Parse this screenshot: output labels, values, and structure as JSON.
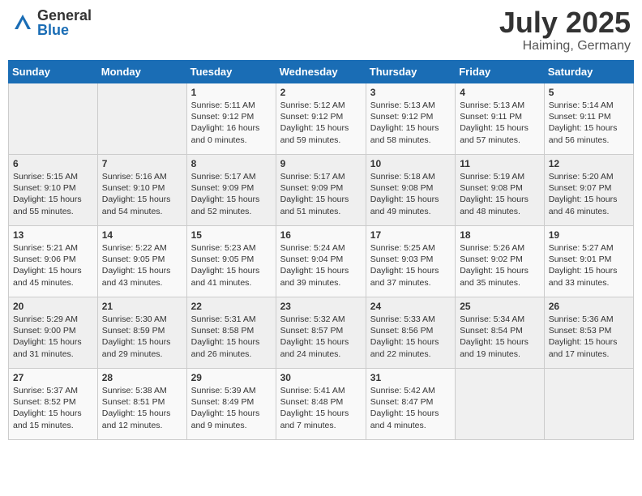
{
  "header": {
    "logo": {
      "general": "General",
      "blue": "Blue"
    },
    "title": "July 2025",
    "location": "Haiming, Germany"
  },
  "days_of_week": [
    "Sunday",
    "Monday",
    "Tuesday",
    "Wednesday",
    "Thursday",
    "Friday",
    "Saturday"
  ],
  "weeks": [
    [
      {
        "day": "",
        "info": ""
      },
      {
        "day": "",
        "info": ""
      },
      {
        "day": "1",
        "info": "Sunrise: 5:11 AM\nSunset: 9:12 PM\nDaylight: 16 hours\nand 0 minutes."
      },
      {
        "day": "2",
        "info": "Sunrise: 5:12 AM\nSunset: 9:12 PM\nDaylight: 15 hours\nand 59 minutes."
      },
      {
        "day": "3",
        "info": "Sunrise: 5:13 AM\nSunset: 9:12 PM\nDaylight: 15 hours\nand 58 minutes."
      },
      {
        "day": "4",
        "info": "Sunrise: 5:13 AM\nSunset: 9:11 PM\nDaylight: 15 hours\nand 57 minutes."
      },
      {
        "day": "5",
        "info": "Sunrise: 5:14 AM\nSunset: 9:11 PM\nDaylight: 15 hours\nand 56 minutes."
      }
    ],
    [
      {
        "day": "6",
        "info": "Sunrise: 5:15 AM\nSunset: 9:10 PM\nDaylight: 15 hours\nand 55 minutes."
      },
      {
        "day": "7",
        "info": "Sunrise: 5:16 AM\nSunset: 9:10 PM\nDaylight: 15 hours\nand 54 minutes."
      },
      {
        "day": "8",
        "info": "Sunrise: 5:17 AM\nSunset: 9:09 PM\nDaylight: 15 hours\nand 52 minutes."
      },
      {
        "day": "9",
        "info": "Sunrise: 5:17 AM\nSunset: 9:09 PM\nDaylight: 15 hours\nand 51 minutes."
      },
      {
        "day": "10",
        "info": "Sunrise: 5:18 AM\nSunset: 9:08 PM\nDaylight: 15 hours\nand 49 minutes."
      },
      {
        "day": "11",
        "info": "Sunrise: 5:19 AM\nSunset: 9:08 PM\nDaylight: 15 hours\nand 48 minutes."
      },
      {
        "day": "12",
        "info": "Sunrise: 5:20 AM\nSunset: 9:07 PM\nDaylight: 15 hours\nand 46 minutes."
      }
    ],
    [
      {
        "day": "13",
        "info": "Sunrise: 5:21 AM\nSunset: 9:06 PM\nDaylight: 15 hours\nand 45 minutes."
      },
      {
        "day": "14",
        "info": "Sunrise: 5:22 AM\nSunset: 9:05 PM\nDaylight: 15 hours\nand 43 minutes."
      },
      {
        "day": "15",
        "info": "Sunrise: 5:23 AM\nSunset: 9:05 PM\nDaylight: 15 hours\nand 41 minutes."
      },
      {
        "day": "16",
        "info": "Sunrise: 5:24 AM\nSunset: 9:04 PM\nDaylight: 15 hours\nand 39 minutes."
      },
      {
        "day": "17",
        "info": "Sunrise: 5:25 AM\nSunset: 9:03 PM\nDaylight: 15 hours\nand 37 minutes."
      },
      {
        "day": "18",
        "info": "Sunrise: 5:26 AM\nSunset: 9:02 PM\nDaylight: 15 hours\nand 35 minutes."
      },
      {
        "day": "19",
        "info": "Sunrise: 5:27 AM\nSunset: 9:01 PM\nDaylight: 15 hours\nand 33 minutes."
      }
    ],
    [
      {
        "day": "20",
        "info": "Sunrise: 5:29 AM\nSunset: 9:00 PM\nDaylight: 15 hours\nand 31 minutes."
      },
      {
        "day": "21",
        "info": "Sunrise: 5:30 AM\nSunset: 8:59 PM\nDaylight: 15 hours\nand 29 minutes."
      },
      {
        "day": "22",
        "info": "Sunrise: 5:31 AM\nSunset: 8:58 PM\nDaylight: 15 hours\nand 26 minutes."
      },
      {
        "day": "23",
        "info": "Sunrise: 5:32 AM\nSunset: 8:57 PM\nDaylight: 15 hours\nand 24 minutes."
      },
      {
        "day": "24",
        "info": "Sunrise: 5:33 AM\nSunset: 8:56 PM\nDaylight: 15 hours\nand 22 minutes."
      },
      {
        "day": "25",
        "info": "Sunrise: 5:34 AM\nSunset: 8:54 PM\nDaylight: 15 hours\nand 19 minutes."
      },
      {
        "day": "26",
        "info": "Sunrise: 5:36 AM\nSunset: 8:53 PM\nDaylight: 15 hours\nand 17 minutes."
      }
    ],
    [
      {
        "day": "27",
        "info": "Sunrise: 5:37 AM\nSunset: 8:52 PM\nDaylight: 15 hours\nand 15 minutes."
      },
      {
        "day": "28",
        "info": "Sunrise: 5:38 AM\nSunset: 8:51 PM\nDaylight: 15 hours\nand 12 minutes."
      },
      {
        "day": "29",
        "info": "Sunrise: 5:39 AM\nSunset: 8:49 PM\nDaylight: 15 hours\nand 9 minutes."
      },
      {
        "day": "30",
        "info": "Sunrise: 5:41 AM\nSunset: 8:48 PM\nDaylight: 15 hours\nand 7 minutes."
      },
      {
        "day": "31",
        "info": "Sunrise: 5:42 AM\nSunset: 8:47 PM\nDaylight: 15 hours\nand 4 minutes."
      },
      {
        "day": "",
        "info": ""
      },
      {
        "day": "",
        "info": ""
      }
    ]
  ]
}
